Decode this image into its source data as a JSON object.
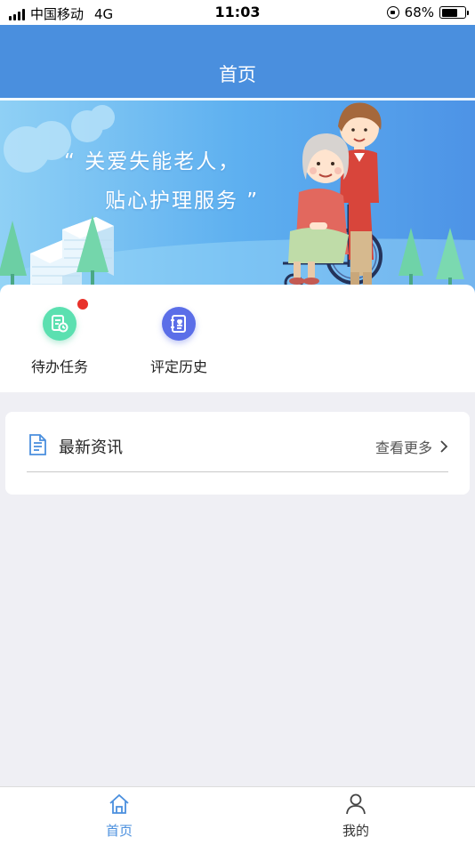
{
  "status_bar": {
    "carrier": "中国移动",
    "network": "4G",
    "time": "11:03",
    "battery_percent": "68%",
    "battery_level": 0.68
  },
  "nav": {
    "title": "首页"
  },
  "banner": {
    "line1": "“ 关爱失能老人，",
    "line2": "贴心护理服务 ”"
  },
  "shortcuts": [
    {
      "label": "待办任务",
      "icon": "todo-task-icon",
      "color": "#5be0b0",
      "has_badge": true
    },
    {
      "label": "评定历史",
      "icon": "assessment-history-icon",
      "color": "#5b6ee8",
      "has_badge": false
    }
  ],
  "news": {
    "title": "最新资讯",
    "more_label": "查看更多",
    "icon": "news-document-icon"
  },
  "tab_bar": {
    "items": [
      {
        "label": "首页",
        "icon": "home-icon",
        "active": true
      },
      {
        "label": "我的",
        "icon": "user-icon",
        "active": false
      }
    ]
  },
  "colors": {
    "primary": "#4a8fde",
    "badge": "#e8312a",
    "background": "#efeff4"
  }
}
